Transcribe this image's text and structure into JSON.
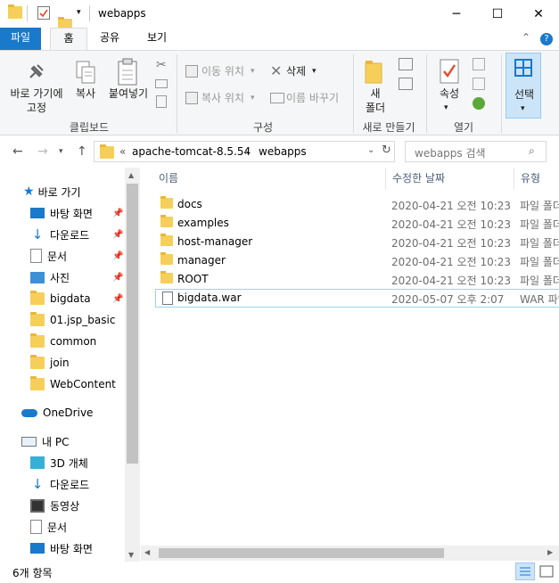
{
  "window": {
    "title": "webapps",
    "minimize": "─",
    "maximize": "☐",
    "close": "✕"
  },
  "ribbon_tabs": {
    "file": "파일",
    "home": "홈",
    "share": "공유",
    "view": "보기",
    "collapse": "⌃",
    "help": "?"
  },
  "ribbon": {
    "pin_label_1": "바로 가기에",
    "pin_label_2": "고정",
    "copy": "복사",
    "paste": "붙여넣기",
    "clipboard_group": "클립보드",
    "move_to": "이동 위치",
    "copy_to": "복사 위치",
    "delete": "삭제",
    "rename": "이름 바꾸기",
    "organize_group": "구성",
    "new_folder_1": "새",
    "new_folder_2": "폴더",
    "new_group": "새로 만들기",
    "properties": "속성",
    "open_group": "열기",
    "select": "선택"
  },
  "address": {
    "chevrons": "«",
    "crumb1": "apache-tomcat-8.5.54",
    "sep": "›",
    "crumb2": "webapps",
    "search_placeholder": "webapps 검색"
  },
  "nav": {
    "quick_access": "바로 가기",
    "items": [
      {
        "label": "바탕 화면",
        "pinned": true
      },
      {
        "label": "다운로드",
        "pinned": true
      },
      {
        "label": "문서",
        "pinned": true
      },
      {
        "label": "사진",
        "pinned": true
      },
      {
        "label": "bigdata",
        "pinned": true
      },
      {
        "label": "01.jsp_basic",
        "pinned": false
      },
      {
        "label": "common",
        "pinned": false
      },
      {
        "label": "join",
        "pinned": false
      },
      {
        "label": "WebContent",
        "pinned": false
      }
    ],
    "onedrive": "OneDrive",
    "this_pc": "내 PC",
    "pc_items": [
      "3D 개체",
      "다운로드",
      "동영상",
      "문서",
      "바탕 화면"
    ]
  },
  "columns": {
    "name": "이름",
    "modified": "수정한 날짜",
    "type": "유형"
  },
  "files": [
    {
      "name": "docs",
      "modified": "2020-04-21 오전 10:23",
      "type": "파일 폴더",
      "kind": "folder"
    },
    {
      "name": "examples",
      "modified": "2020-04-21 오전 10:23",
      "type": "파일 폴더",
      "kind": "folder"
    },
    {
      "name": "host-manager",
      "modified": "2020-04-21 오전 10:23",
      "type": "파일 폴더",
      "kind": "folder"
    },
    {
      "name": "manager",
      "modified": "2020-04-21 오전 10:23",
      "type": "파일 폴더",
      "kind": "folder"
    },
    {
      "name": "ROOT",
      "modified": "2020-04-21 오전 10:23",
      "type": "파일 폴더",
      "kind": "folder"
    },
    {
      "name": "bigdata.war",
      "modified": "2020-05-07 오후 2:07",
      "type": "WAR 파일",
      "kind": "file"
    }
  ],
  "status": {
    "count": "6개 항목"
  },
  "colors": {
    "accent": "#1979ca",
    "folder": "#f6cf5b",
    "selection_border": "#99d1ff"
  }
}
